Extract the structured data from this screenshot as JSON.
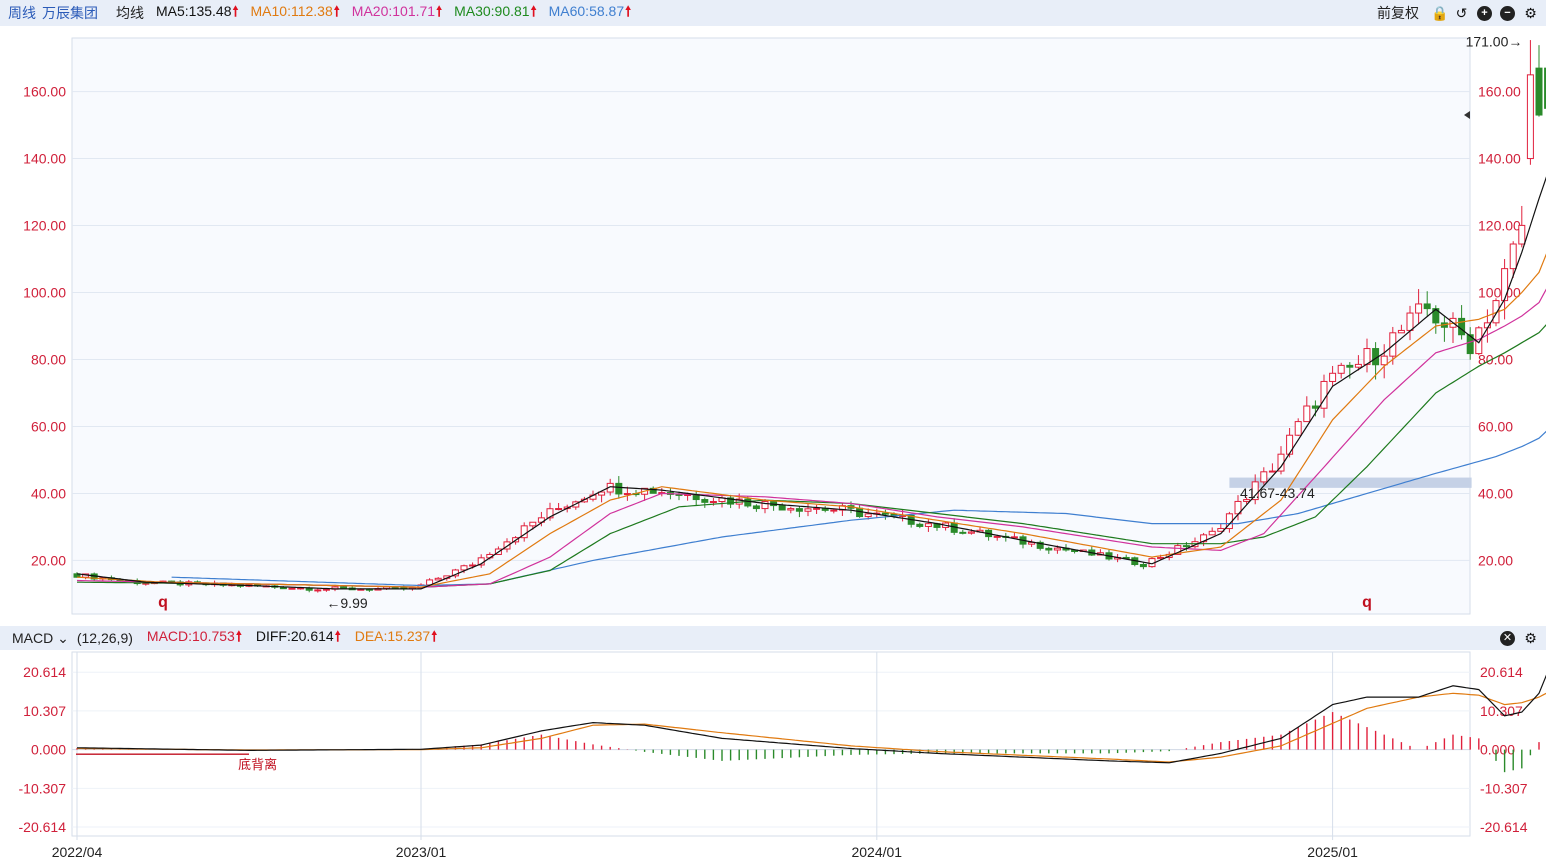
{
  "topbar": {
    "period": "周线",
    "stock": "万辰集团",
    "ma_label": "均线",
    "ma": [
      {
        "text": "MA5:135.48",
        "color": "#111111"
      },
      {
        "text": "MA10:112.38",
        "color": "#e07a10"
      },
      {
        "text": "MA20:101.71",
        "color": "#d0329c"
      },
      {
        "text": "MA30:90.81",
        "color": "#1e8a1e"
      },
      {
        "text": "MA60:58.87",
        "color": "#3f7fd0"
      }
    ],
    "fuquan": "前复权",
    "icons": [
      "lock-icon",
      "undo-icon",
      "zoom-in-icon",
      "zoom-out-icon",
      "gear-icon"
    ]
  },
  "macdbar": {
    "label": "MACD",
    "params": "(12,26,9)",
    "macd": "MACD:10.753",
    "diff": "DIFF:20.614",
    "dea": "DEA:15.237"
  },
  "colors": {
    "up": "#e0203c",
    "down": "#2a8a2a",
    "ma5": "#111111",
    "ma10": "#e07a10",
    "ma20": "#d0329c",
    "ma30": "#1e7a1e",
    "ma60": "#3f7fd0",
    "axis": "#d0203a"
  },
  "chart_data": [
    {
      "type": "candlestick",
      "title": "万辰集团 周线",
      "ylim": [
        4,
        176
      ],
      "yticks": [
        20,
        40,
        60,
        80,
        100,
        120,
        140,
        160
      ],
      "ytick_labels": [
        "20.00",
        "40.00",
        "60.00",
        "80.00",
        "100.00",
        "120.00",
        "140.00",
        "160.00"
      ],
      "xtick_labels": [
        {
          "label": "2022/04",
          "index": 0
        },
        {
          "label": "2023/01",
          "index": 40
        },
        {
          "label": "2024/01",
          "index": 93
        },
        {
          "label": "2025/01",
          "index": 146
        }
      ],
      "annotations": [
        {
          "text": "171.00→",
          "index": 169,
          "value": 171.0
        },
        {
          "text": "←9.99",
          "index": 29,
          "value": 9.99
        },
        {
          "text": "41.67-43.74",
          "index": 135,
          "value": 41.67
        }
      ],
      "markers": [
        {
          "text": "q",
          "index": 10
        },
        {
          "text": "q",
          "index": 150
        }
      ],
      "band": {
        "low": 41.67,
        "high": 43.74,
        "from_index": 134
      },
      "last_price_marker": 153,
      "ma_lines": {
        "ma5": [
          [
            0,
            16
          ],
          [
            8,
            13.5
          ],
          [
            20,
            12.5
          ],
          [
            30,
            11.5
          ],
          [
            40,
            11.5
          ],
          [
            47,
            19
          ],
          [
            55,
            33
          ],
          [
            62,
            42
          ],
          [
            68,
            41
          ],
          [
            80,
            37
          ],
          [
            90,
            35
          ],
          [
            100,
            31
          ],
          [
            110,
            26
          ],
          [
            125,
            19
          ],
          [
            133,
            28
          ],
          [
            140,
            48
          ],
          [
            146,
            72
          ],
          [
            152,
            82
          ],
          [
            158,
            95
          ],
          [
            163,
            85
          ],
          [
            166,
            98
          ],
          [
            168,
            112
          ],
          [
            170,
            128
          ],
          [
            171,
            135.5
          ]
        ],
        "ma10": [
          [
            0,
            15
          ],
          [
            10,
            13.5
          ],
          [
            40,
            12
          ],
          [
            48,
            16
          ],
          [
            55,
            28
          ],
          [
            62,
            38
          ],
          [
            68,
            42
          ],
          [
            80,
            38
          ],
          [
            90,
            36
          ],
          [
            100,
            32
          ],
          [
            110,
            28
          ],
          [
            125,
            21
          ],
          [
            133,
            24
          ],
          [
            140,
            38
          ],
          [
            146,
            62
          ],
          [
            152,
            78
          ],
          [
            158,
            90
          ],
          [
            163,
            92
          ],
          [
            166,
            95
          ],
          [
            168,
            100
          ],
          [
            170,
            106
          ],
          [
            171,
            112.4
          ]
        ],
        "ma20": [
          [
            0,
            14
          ],
          [
            20,
            13
          ],
          [
            40,
            12
          ],
          [
            48,
            13
          ],
          [
            55,
            21
          ],
          [
            62,
            34
          ],
          [
            68,
            40
          ],
          [
            80,
            39
          ],
          [
            90,
            37
          ],
          [
            100,
            33
          ],
          [
            110,
            30
          ],
          [
            125,
            24
          ],
          [
            133,
            23
          ],
          [
            138,
            28
          ],
          [
            144,
            45
          ],
          [
            152,
            68
          ],
          [
            158,
            82
          ],
          [
            163,
            86
          ],
          [
            166,
            90
          ],
          [
            168,
            93
          ],
          [
            170,
            97
          ],
          [
            171,
            101.7
          ]
        ],
        "ma30": [
          [
            0,
            13.5
          ],
          [
            20,
            13
          ],
          [
            40,
            12
          ],
          [
            48,
            13
          ],
          [
            55,
            17
          ],
          [
            62,
            28
          ],
          [
            70,
            36
          ],
          [
            80,
            38
          ],
          [
            90,
            37
          ],
          [
            100,
            34
          ],
          [
            110,
            31
          ],
          [
            125,
            25
          ],
          [
            133,
            25
          ],
          [
            138,
            27
          ],
          [
            144,
            33
          ],
          [
            150,
            48
          ],
          [
            158,
            70
          ],
          [
            163,
            78
          ],
          [
            166,
            82
          ],
          [
            168,
            85
          ],
          [
            170,
            88
          ],
          [
            171,
            90.8
          ]
        ],
        "ma60": [
          [
            11,
            15
          ],
          [
            40,
            12.5
          ],
          [
            48,
            13
          ],
          [
            60,
            20
          ],
          [
            75,
            27
          ],
          [
            90,
            32
          ],
          [
            102,
            35
          ],
          [
            115,
            34
          ],
          [
            125,
            31
          ],
          [
            135,
            31
          ],
          [
            142,
            34
          ],
          [
            150,
            40
          ],
          [
            158,
            46
          ],
          [
            165,
            51
          ],
          [
            168,
            54
          ],
          [
            170,
            56.5
          ],
          [
            171,
            58.9
          ]
        ]
      }
    },
    {
      "type": "macd",
      "params": "(12,26,9)",
      "ylim": [
        -23,
        26
      ],
      "yticks": [
        20.614,
        10.307,
        0,
        -10.307,
        -20.614
      ],
      "ytick_labels": [
        "20.614",
        "10.307",
        "0.000",
        "-10.307",
        "-20.614"
      ],
      "annotation": {
        "text": "底背离",
        "index": 21
      },
      "diff": [
        [
          0,
          0.5
        ],
        [
          20,
          -0.2
        ],
        [
          40,
          0.1
        ],
        [
          47,
          1.2
        ],
        [
          54,
          5
        ],
        [
          60,
          7.2
        ],
        [
          66,
          6.5
        ],
        [
          75,
          3
        ],
        [
          90,
          0.3
        ],
        [
          100,
          -1
        ],
        [
          110,
          -2
        ],
        [
          120,
          -3
        ],
        [
          127,
          -3.5
        ],
        [
          133,
          -1
        ],
        [
          140,
          3
        ],
        [
          146,
          12
        ],
        [
          150,
          14
        ],
        [
          156,
          14
        ],
        [
          160,
          17
        ],
        [
          163,
          16
        ],
        [
          166,
          9
        ],
        [
          168,
          10
        ],
        [
          170,
          15
        ],
        [
          171,
          20.6
        ]
      ],
      "dea": [
        [
          0,
          0.3
        ],
        [
          20,
          -0.1
        ],
        [
          40,
          0
        ],
        [
          47,
          0.5
        ],
        [
          54,
          3
        ],
        [
          60,
          6.5
        ],
        [
          66,
          6.8
        ],
        [
          75,
          4.5
        ],
        [
          90,
          1
        ],
        [
          100,
          -0.5
        ],
        [
          110,
          -1.5
        ],
        [
          120,
          -2.5
        ],
        [
          127,
          -3.3
        ],
        [
          133,
          -2
        ],
        [
          140,
          1
        ],
        [
          146,
          7
        ],
        [
          150,
          11
        ],
        [
          156,
          14
        ],
        [
          160,
          15
        ],
        [
          163,
          14.5
        ],
        [
          166,
          12
        ],
        [
          168,
          12.5
        ],
        [
          170,
          14
        ],
        [
          171,
          15.2
        ]
      ],
      "macd_last": 10.753
    }
  ]
}
